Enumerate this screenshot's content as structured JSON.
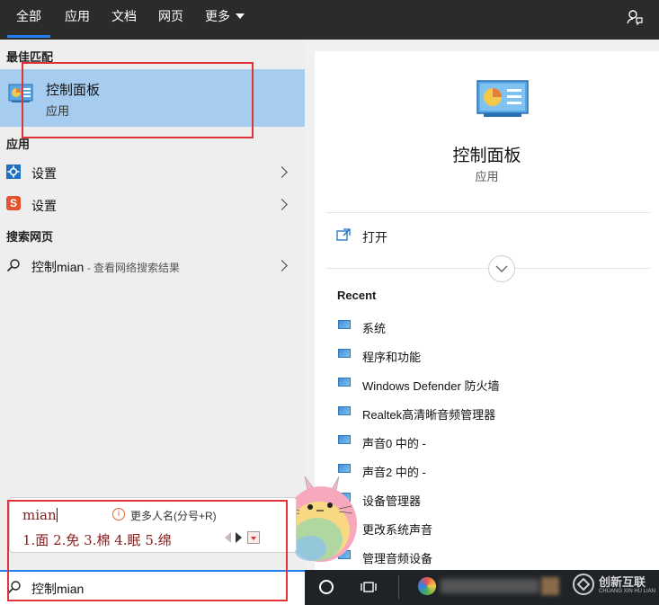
{
  "header": {
    "tabs": [
      {
        "label": "全部",
        "active": true
      },
      {
        "label": "应用"
      },
      {
        "label": "文档"
      },
      {
        "label": "网页"
      },
      {
        "label": "更多"
      }
    ]
  },
  "left": {
    "best_match_title": "最佳匹配",
    "best_match": {
      "name": "控制面板",
      "type": "应用"
    },
    "apps_title": "应用",
    "apps": [
      {
        "label": "设置"
      },
      {
        "label": "设置"
      }
    ],
    "web_title": "搜索网页",
    "web_item": {
      "query": "控制mian",
      "suffix": " - 查看网络搜索结果"
    }
  },
  "detail": {
    "title": "控制面板",
    "subtitle": "应用",
    "open_label": "打开",
    "recent_title": "Recent",
    "recent": [
      "系统",
      "程序和功能",
      "Windows Defender 防火墙",
      "Realtek高清晰音频管理器",
      "声音0 中的 -",
      "声音2 中的 -",
      "设备管理器",
      "更改系统声音",
      "管理音频设备"
    ]
  },
  "ime": {
    "composition": "mian",
    "hint": "更多人名(分号+R)",
    "candidates": "1.面 2.免 3.棉 4.眠 5.绵"
  },
  "search": {
    "value": "控制mian"
  },
  "watermark": {
    "text": "创新互联",
    "sub": "CHUANG XIN HU LIAN"
  },
  "colors": {
    "accent": "#1e7ff0",
    "selection": "#a6cdef",
    "highlight_box": "#e0343a"
  }
}
